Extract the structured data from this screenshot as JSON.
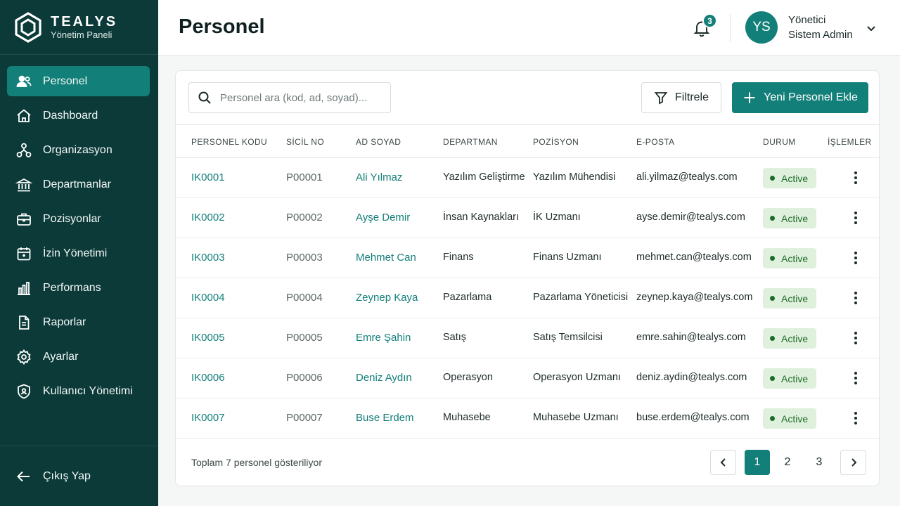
{
  "brand": {
    "name": "TEALYS",
    "subtitle": "Yönetim Paneli"
  },
  "sidebar": {
    "items": [
      {
        "label": "Personel",
        "icon": "users-icon",
        "active": true
      },
      {
        "label": "Dashboard",
        "icon": "home-icon"
      },
      {
        "label": "Organizasyon",
        "icon": "org-chart-icon"
      },
      {
        "label": "Departmanlar",
        "icon": "bank-icon"
      },
      {
        "label": "Pozisyonlar",
        "icon": "briefcase-icon"
      },
      {
        "label": "İzin Yönetimi",
        "icon": "calendar-icon"
      },
      {
        "label": "Performans",
        "icon": "bar-chart-icon"
      },
      {
        "label": "Raporlar",
        "icon": "document-icon"
      },
      {
        "label": "Ayarlar",
        "icon": "gear-icon"
      },
      {
        "label": "Kullanıcı Yönetimi",
        "icon": "shield-icon"
      }
    ],
    "logout_label": "Çıkış Yap"
  },
  "header": {
    "title": "Personel",
    "notification_count": "3",
    "user": {
      "initials": "YS",
      "role": "Yönetici",
      "name": "Sistem Admin"
    }
  },
  "toolbar": {
    "search_placeholder": "Personel ara (kod, ad, soyad)...",
    "filter_label": "Filtrele",
    "add_label": "Yeni Personel Ekle"
  },
  "table": {
    "columns": [
      "PERSONEL KODU",
      "SİCİL NO",
      "AD SOYAD",
      "DEPARTMAN",
      "POZİSYON",
      "E-POSTA",
      "DURUM",
      "İŞLEMLER"
    ],
    "rows": [
      {
        "code": "IK0001",
        "reg": "P00001",
        "name": "Ali Yılmaz",
        "dept": "Yazılım Geliştirme",
        "position": "Yazılım Mühendisi",
        "email": "ali.yilmaz@tealys.com",
        "status": "Active"
      },
      {
        "code": "IK0002",
        "reg": "P00002",
        "name": "Ayşe Demir",
        "dept": "İnsan Kaynakları",
        "position": "İK Uzmanı",
        "email": "ayse.demir@tealys.com",
        "status": "Active"
      },
      {
        "code": "IK0003",
        "reg": "P00003",
        "name": "Mehmet Can",
        "dept": "Finans",
        "position": "Finans Uzmanı",
        "email": "mehmet.can@tealys.com",
        "status": "Active"
      },
      {
        "code": "IK0004",
        "reg": "P00004",
        "name": "Zeynep Kaya",
        "dept": "Pazarlama",
        "position": "Pazarlama Yöneticisi",
        "email": "zeynep.kaya@tealys.com",
        "status": "Active"
      },
      {
        "code": "IK0005",
        "reg": "P00005",
        "name": "Emre Şahin",
        "dept": "Satış",
        "position": "Satış Temsilcisi",
        "email": "emre.sahin@tealys.com",
        "status": "Active"
      },
      {
        "code": "IK0006",
        "reg": "P00006",
        "name": "Deniz Aydın",
        "dept": "Operasyon",
        "position": "Operasyon Uzmanı",
        "email": "deniz.aydin@tealys.com",
        "status": "Active"
      },
      {
        "code": "IK0007",
        "reg": "P00007",
        "name": "Buse Erdem",
        "dept": "Muhasebe",
        "position": "Muhasebe Uzmanı",
        "email": "buse.erdem@tealys.com",
        "status": "Active"
      }
    ]
  },
  "footer": {
    "summary": "Toplam 7 personel gösteriliyor",
    "pages": [
      "1",
      "2",
      "3"
    ],
    "current_page": "1"
  },
  "colors": {
    "sidebar_bg": "#0b3a38",
    "accent": "#137f79",
    "status_bg": "#dff1dc",
    "status_text": "#1f6b2a"
  }
}
